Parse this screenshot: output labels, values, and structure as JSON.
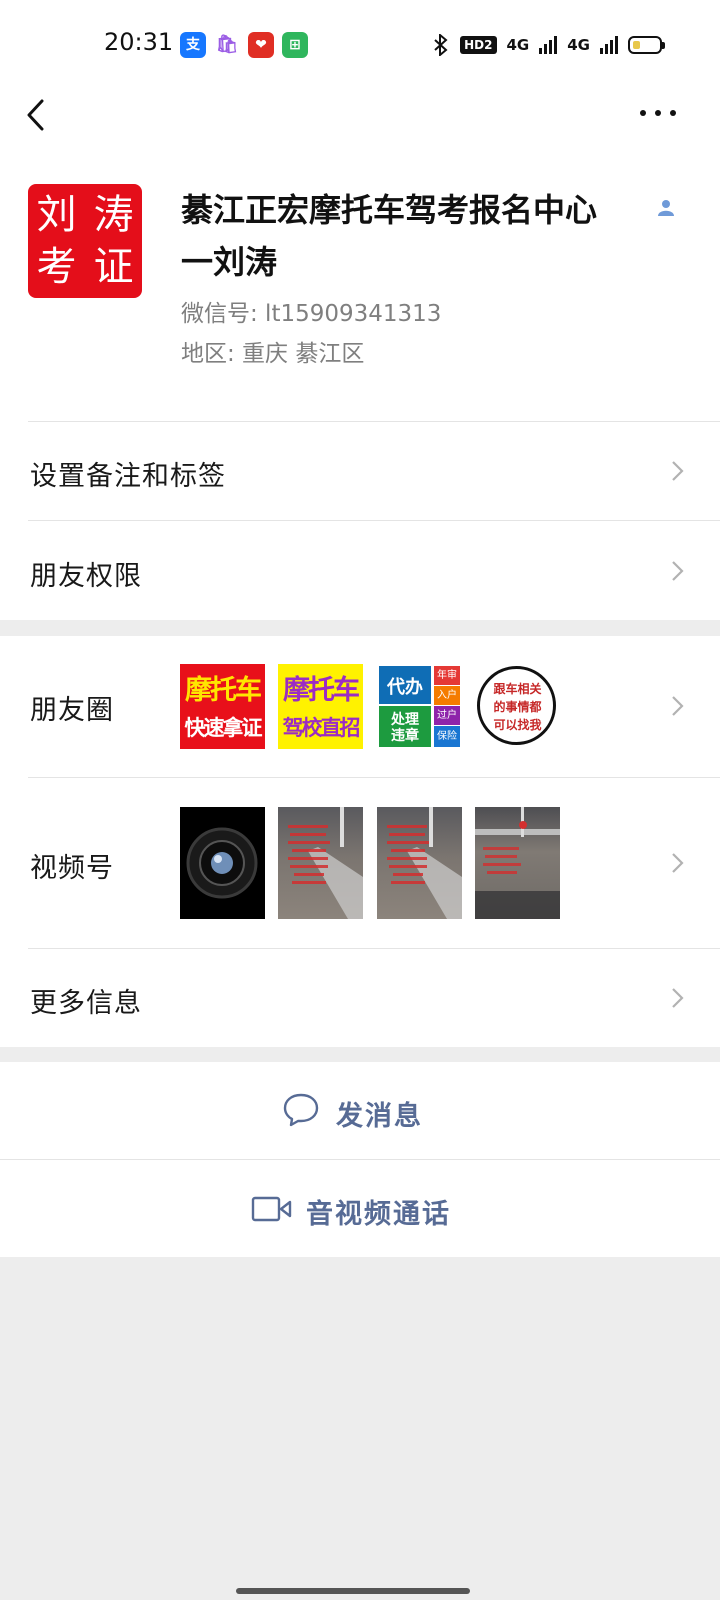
{
  "status_bar": {
    "time": "20:31",
    "app_icons": [
      "alipay-icon",
      "shopping-bag-icon",
      "pinduoduo-icon",
      "bag-app-icon"
    ],
    "hd_badge": "HD2",
    "network_1": "4G",
    "network_2": "4G",
    "battery_level": 0.25
  },
  "nav": {
    "back_icon": "chevron-left-icon",
    "more_icon": "more-dots-icon"
  },
  "profile": {
    "avatar_chars": [
      "刘",
      "涛",
      "考",
      "证"
    ],
    "name_line1": "綦江正宏摩托车驾考报名中心",
    "name_line2": "一刘涛",
    "wechat_id": "微信号: lt15909341313",
    "region": "地区: 重庆  綦江区"
  },
  "menu": {
    "remark_tags": "设置备注和标签",
    "friend_permissions": "朋友权限",
    "moments": "朋友圈",
    "channels": "视频号",
    "more_info": "更多信息"
  },
  "moments_thumbs": [
    {
      "line1": "摩托车",
      "line2": "快速拿证"
    },
    {
      "line1": "摩托车",
      "line2": "驾校直招"
    },
    {
      "line1": "代办",
      "line2": "处理违章",
      "side": [
        "年审",
        "入户",
        "过户",
        "保险"
      ]
    },
    {
      "line1": "跟车相关",
      "line2": "的事情都",
      "line3": "可以找我"
    }
  ],
  "actions": {
    "send_message": "发消息",
    "video_call": "音视频通话"
  },
  "colors": {
    "link": "#576b95",
    "avatar_red": "#e40e1a",
    "background": "#ededed"
  }
}
